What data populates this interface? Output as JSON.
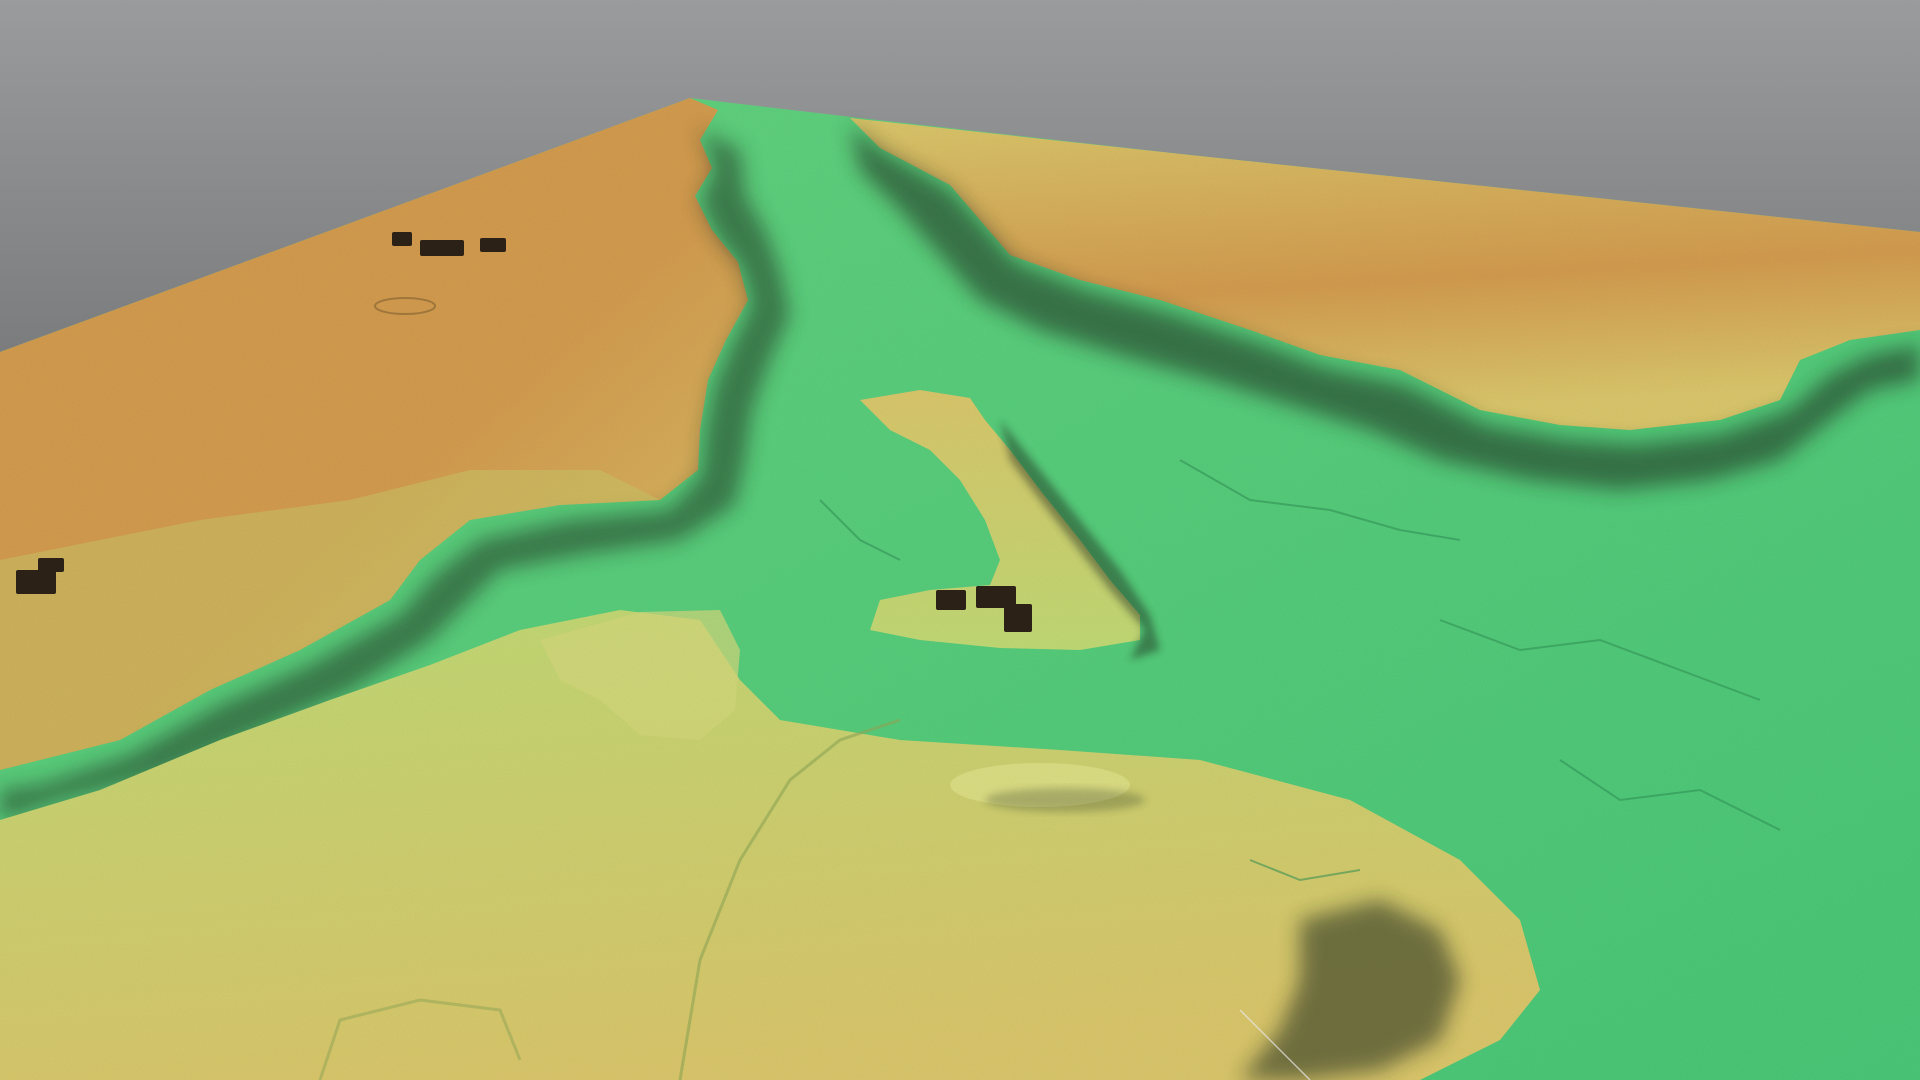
{
  "scene": {
    "kind": "3d-terrain-elevation-model",
    "description_visible_text": "",
    "colors": {
      "background_top": "#9a9b9d",
      "background_bottom": "#3b3c3e",
      "high_ground": "#d19a4e",
      "mid_high_ground": "#d8c56a",
      "mid_ground": "#bfd874",
      "low_ground": "#63d17e",
      "channel_floor": "#49c576",
      "escarpment_shadow": "#1b2a1e",
      "buildings": "#2c2117"
    },
    "legend": "none",
    "toolbar": "none"
  }
}
